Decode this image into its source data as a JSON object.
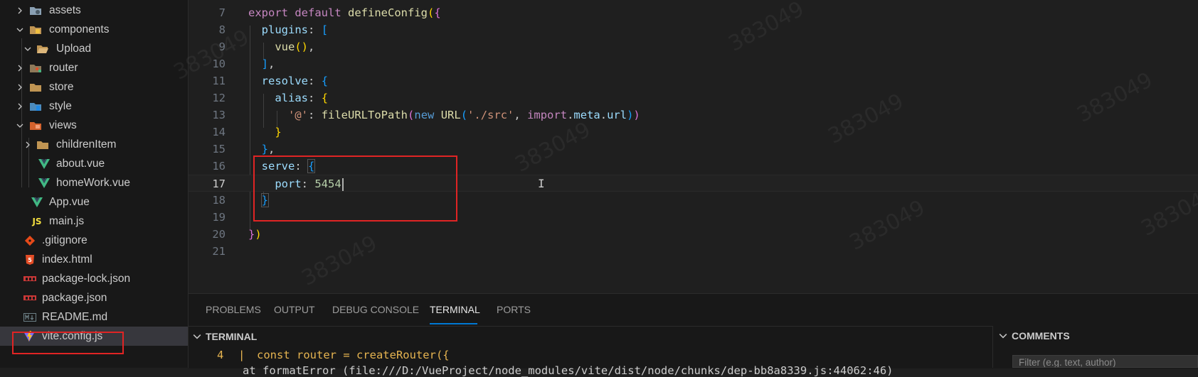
{
  "explorer": {
    "items": [
      {
        "label": "assets",
        "icon": "assets-folder-icon"
      },
      {
        "label": "components",
        "icon": "components-folder-icon"
      },
      {
        "label": "Upload",
        "icon": "folder-open-icon"
      },
      {
        "label": "router",
        "icon": "router-folder-icon"
      },
      {
        "label": "store",
        "icon": "folder-icon"
      },
      {
        "label": "style",
        "icon": "style-folder-icon"
      },
      {
        "label": "views",
        "icon": "views-folder-icon"
      },
      {
        "label": "childrenItem",
        "icon": "folder-icon"
      },
      {
        "label": "about.vue",
        "icon": "vue-file-icon"
      },
      {
        "label": "homeWork.vue",
        "icon": "vue-file-icon"
      },
      {
        "label": "App.vue",
        "icon": "vue-file-icon"
      },
      {
        "label": "main.js",
        "icon": "js-file-icon"
      },
      {
        "label": ".gitignore",
        "icon": "git-file-icon"
      },
      {
        "label": "index.html",
        "icon": "html5-file-icon"
      },
      {
        "label": "package-lock.json",
        "icon": "npm-file-icon"
      },
      {
        "label": "package.json",
        "icon": "npm-file-icon"
      },
      {
        "label": "README.md",
        "icon": "markdown-file-icon"
      },
      {
        "label": "vite.config.js",
        "icon": "vite-file-icon"
      }
    ],
    "selected": "vite.config.js"
  },
  "editor": {
    "line_numbers": [
      "7",
      "8",
      "9",
      "10",
      "11",
      "12",
      "13",
      "14",
      "15",
      "16",
      "17",
      "18",
      "19",
      "20",
      "21"
    ],
    "active_line": "17",
    "code": {
      "l7": [
        "export",
        "default",
        "defineConfig",
        "(",
        "{"
      ],
      "l8": [
        "plugins",
        ":",
        "["
      ],
      "l9": [
        "vue",
        "()",
        ","
      ],
      "l10": [
        "]",
        ","
      ],
      "l11": [
        "resolve",
        ":",
        "{"
      ],
      "l12": [
        "alias",
        ":",
        "{"
      ],
      "l13": [
        "'@'",
        ":",
        "fileURLToPath",
        "(",
        "new",
        "URL",
        "(",
        "'./src'",
        ",",
        "import",
        ".",
        "meta",
        ".",
        "url",
        ")",
        ")"
      ],
      "l14": [
        "}"
      ],
      "l15": [
        "}",
        ","
      ],
      "l16": [
        "serve",
        ":",
        "{"
      ],
      "l17": [
        "port",
        ":",
        "5454"
      ],
      "l18": [
        "}"
      ],
      "l19": [],
      "l20": [
        "}",
        ")"
      ],
      "l21": []
    }
  },
  "watermark": "383049",
  "panel": {
    "tabs": [
      "PROBLEMS",
      "OUTPUT",
      "DEBUG CONSOLE",
      "TERMINAL",
      "PORTS"
    ],
    "active_tab": "TERMINAL",
    "terminal_header": "TERMINAL",
    "comments_header": "COMMENTS",
    "filter_placeholder": "Filter (e.g. text, author)",
    "terminal_lines": {
      "line1_num": "4",
      "line1_sep": "|",
      "line1_code": "const router = createRouter({",
      "line2": "at formatError (file:///D:/VueProject/node_modules/vite/dist/node/chunks/dep-bb8a8339.js:44062:46)"
    }
  },
  "colors": {
    "highlight_box": "#e02424",
    "accent": "#0078d4",
    "vue_green": "#41b883",
    "js_yellow": "#f1dd3f"
  }
}
